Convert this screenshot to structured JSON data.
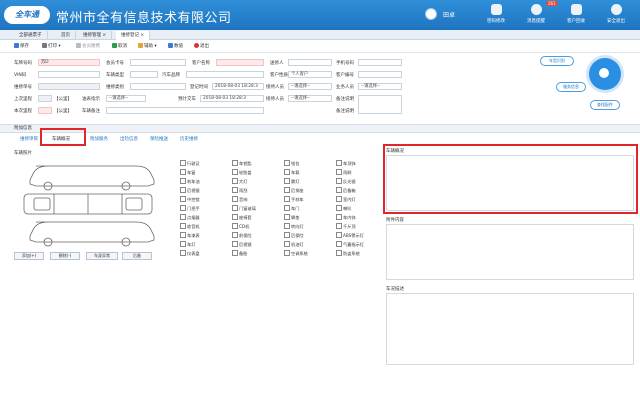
{
  "header": {
    "logo": "全车通",
    "company": "常州市全有信息技术有限公司",
    "username": "田卓",
    "buttons": [
      "密码修改",
      "消息提醒",
      "客户回收",
      "安全退出"
    ],
    "badge": "261"
  },
  "tabs": [
    "全部通票子",
    "首页",
    "维修管理 ×",
    "维修登记 ×"
  ],
  "toolbar": [
    "保存",
    "打印",
    "会员缴费",
    "取消",
    "辅助",
    "数值",
    "退出"
  ],
  "form": {
    "row1": {
      "a": "车牌号码",
      "a_val": "苏D",
      "b": "会员卡号",
      "c": "客户名称",
      "d": "送修人",
      "e": "手机号码"
    },
    "row2": {
      "a": "VIN码",
      "b": "车辆类型",
      "c": "汽车品牌",
      "d": "客户性质",
      "d_val": "个人客户",
      "e": "客户编号"
    },
    "row3": {
      "a": "维修单号",
      "b": "维修类别",
      "c": "登记时间",
      "c_val": "2018-08-03 18:28:3",
      "d": "接待人员",
      "d_val": "--请选择--",
      "e": "业务人员",
      "e_val": "--请选择--"
    },
    "row4": {
      "a": "上次里程",
      "a_tag": "【公里】",
      "b": "油表指示",
      "b_val": "--请选择--",
      "c": "预计交车",
      "c_val": "2018-08-03 18:28:3",
      "d": "接待人员",
      "d_val": "--请选择--",
      "e": "备注说明"
    },
    "row5": {
      "a": "本次里程",
      "a_tag": "【公里】",
      "b": "车辆备注",
      "c": "备注说明"
    }
  },
  "side_buttons": [
    "车型识别",
    "服务信息",
    "查找配件"
  ],
  "section": {
    "title": "附加信息",
    "subtabs": [
      "维修项目",
      "车辆概况",
      "附加服务",
      "出险信息",
      "保险推送",
      "历史维修"
    ]
  },
  "vehicle": {
    "label": "车辆照片",
    "buttons": [
      "添加(+)",
      "删除(-)",
      "车身异常",
      "后备"
    ]
  },
  "checkboxes": [
    [
      "行驶证",
      "车钥匙",
      "钱包",
      "车顶饰"
    ],
    [
      "车窗",
      "轮胎盖",
      "车载",
      "雨刷"
    ],
    [
      "刹车油",
      "大灯",
      "雾灯",
      "反光镜"
    ],
    [
      "后视镜",
      "雨刮",
      "后排座",
      "后备箱"
    ],
    [
      "中控锁",
      "音响",
      "手刹车",
      "室内灯"
    ],
    [
      "门把手",
      "门窗玻璃",
      "车门",
      "喇叭"
    ],
    [
      "点烟器",
      "座椅套",
      "脚垫",
      "车内饰"
    ],
    [
      "收音机",
      "CD机",
      "转向灯",
      "千斤顶"
    ],
    [
      "车漆表",
      "前保险",
      "后保险",
      "ABS警示灯"
    ],
    [
      "车灯",
      "后视镜",
      "机油灯",
      "气囊指示灯"
    ],
    [
      "仪表盘",
      "备胎",
      "空调系统",
      "防盗系统"
    ]
  ],
  "right_panels": [
    "车辆概况",
    "附件内容",
    "车况描述"
  ]
}
